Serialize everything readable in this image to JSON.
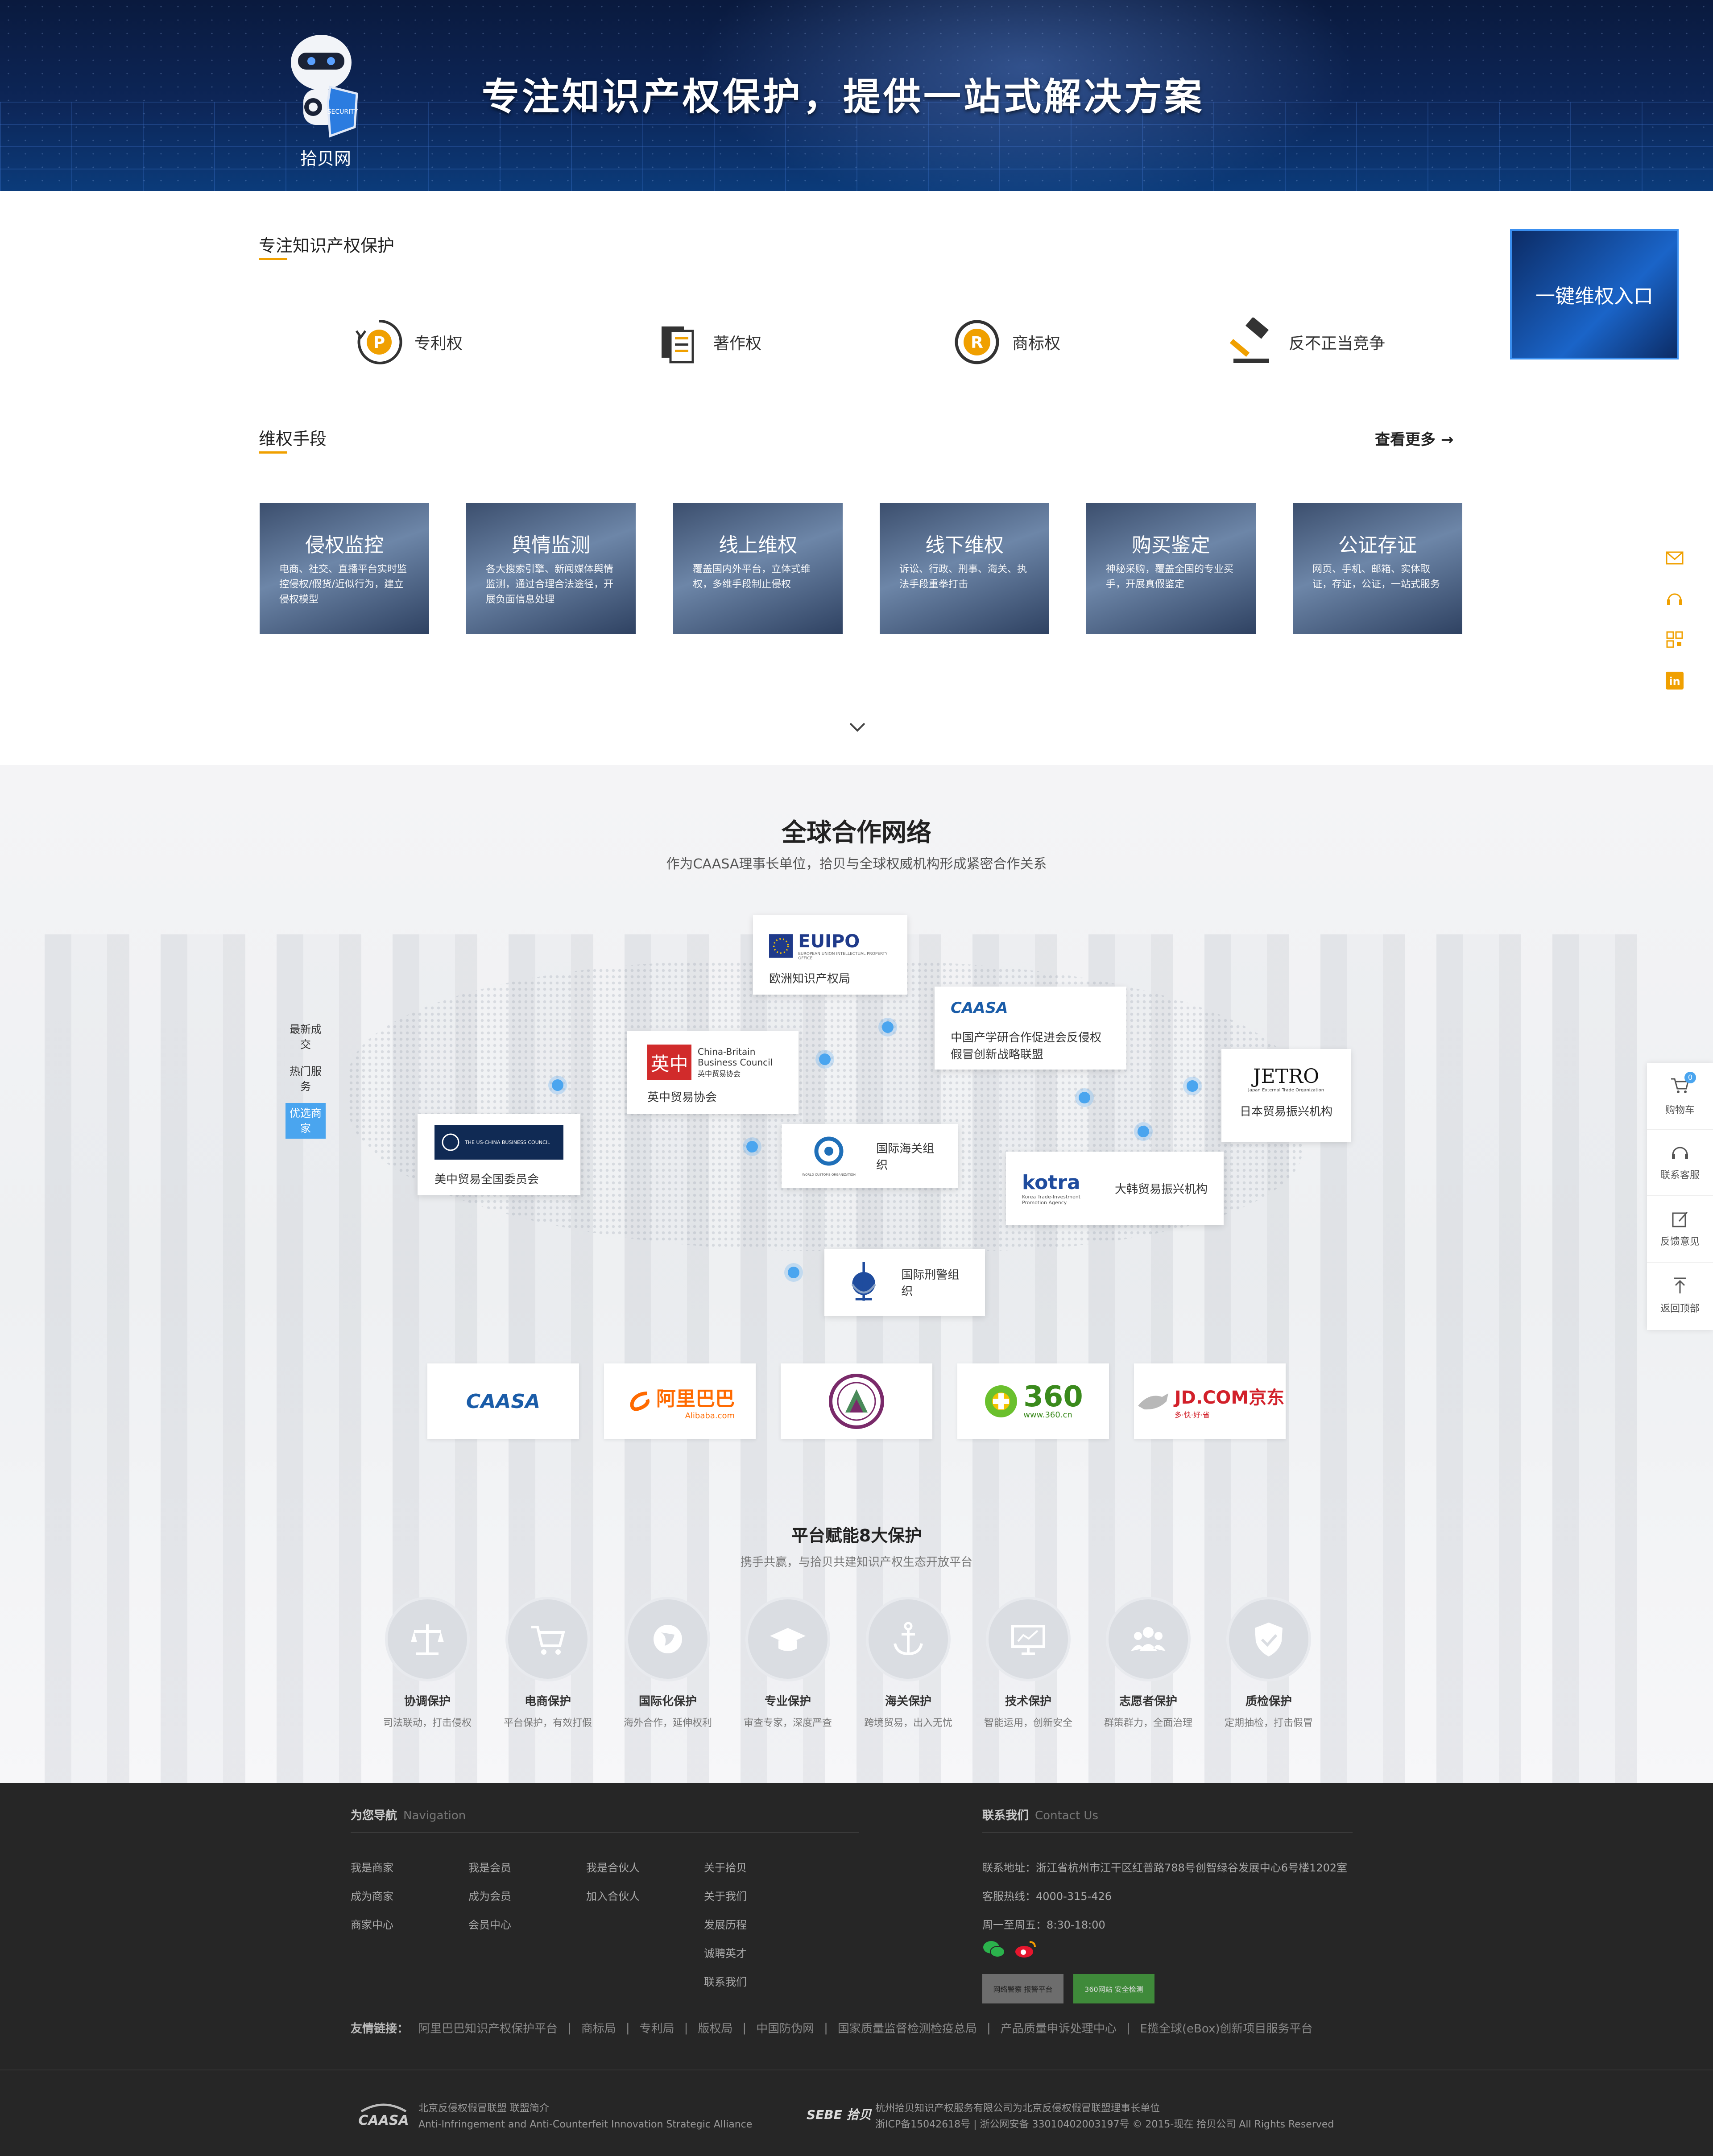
{
  "hero": {
    "slogan": "专注知识产权保护，提供一站式解决方案",
    "logo_text": "拾贝网",
    "colors": {
      "bg": "#0d2658",
      "accent": "#f0a000"
    }
  },
  "ip": {
    "title": "专注知识产权保护",
    "items": [
      {
        "label": "专利权",
        "icon": "patent-icon"
      },
      {
        "label": "著作权",
        "icon": "copyright-document-icon"
      },
      {
        "label": "商标权",
        "icon": "trademark-icon"
      },
      {
        "label": "反不正当竞争",
        "icon": "gavel-icon"
      }
    ],
    "oneclick_label": "一键维权入口"
  },
  "methods": {
    "title": "维权手段",
    "more_label": "查看更多",
    "cards": [
      {
        "title": "侵权监控",
        "desc": "电商、社交、直播平台实时监控侵权/假货/近似行为，建立侵权模型"
      },
      {
        "title": "舆情监测",
        "desc": "各大搜索引擎、新闻媒体舆情监测，通过合理合法途径，开展负面信息处理"
      },
      {
        "title": "线上维权",
        "desc": "覆盖国内外平台，立体式维权，多维手段制止侵权"
      },
      {
        "title": "线下维权",
        "desc": "诉讼、行政、刑事、海关、执法手段重拳打击"
      },
      {
        "title": "购买鉴定",
        "desc": "神秘采购，覆盖全国的专业买手，开展真假鉴定"
      },
      {
        "title": "公证存证",
        "desc": "网页、手机、邮箱、实体取证，存证，公证，一站式服务"
      }
    ]
  },
  "global": {
    "title": "全球合作网络",
    "subtitle": "作为CAASA理事长单位，拾贝与全球权威机构形成紧密合作关系",
    "side_labels": [
      "最新成交",
      "热门服务",
      "优选商家"
    ],
    "partners": {
      "euipo": {
        "logo": "EUIPO",
        "logo_sub": "EUROPEAN UNION INTELLECTUAL PROPERTY OFFICE",
        "name": "欧洲知识产权局"
      },
      "caasa": {
        "logo": "CAASA",
        "name": "中国产学研合作促进会反侵权假冒创新战略联盟"
      },
      "cbbc": {
        "logo_cn": "英中",
        "logo_en": "China-Britain Business Council",
        "logo_sub": "英中贸易协会",
        "name": "英中贸易协会"
      },
      "jetro": {
        "logo": "JETRO",
        "logo_sub": "Japan External Trade Organization",
        "name": "日本贸易振兴机构"
      },
      "uscbc": {
        "logo": "THE US-CHINA BUSINESS COUNCIL",
        "name": "美中贸易全国委员会"
      },
      "wco": {
        "logo_sub": "WORLD CUSTOMS ORGANIZATION",
        "name": "国际海关组织"
      },
      "kotra": {
        "logo": "kotra",
        "logo_sub": "Korea Trade-Investment Promotion Agency",
        "name": "大韩贸易振兴机构"
      },
      "interpol": {
        "name": "国际刑警组织"
      }
    },
    "brands": [
      {
        "name": "caasa",
        "text": "CAASA"
      },
      {
        "name": "alibaba",
        "text": "阿里巴巴",
        "sub": "Alibaba.com"
      },
      {
        "name": "emblem",
        "text": ""
      },
      {
        "name": "360",
        "text": "360",
        "sub": "www.360.cn"
      },
      {
        "name": "jd",
        "text": "JD.COM京东",
        "sub": "多·快·好·省"
      }
    ]
  },
  "protection": {
    "title": "平台赋能8大保护",
    "subtitle": "携手共赢，与拾贝共建知识产权生态开放平台",
    "items": [
      {
        "name": "协调保护",
        "desc": "司法联动，打击侵权",
        "icon": "scales-icon"
      },
      {
        "name": "电商保护",
        "desc": "平台保护，有效打假",
        "icon": "cart-icon"
      },
      {
        "name": "国际化保护",
        "desc": "海外合作，延伸权利",
        "icon": "globe-icon"
      },
      {
        "name": "专业保护",
        "desc": "审查专家，深度严查",
        "icon": "graduation-cap-icon"
      },
      {
        "name": "海关保护",
        "desc": "跨境贸易，出入无忧",
        "icon": "anchor-icon"
      },
      {
        "name": "技术保护",
        "desc": "智能运用，创新安全",
        "icon": "monitor-icon"
      },
      {
        "name": "志愿者保护",
        "desc": "群策群力，全面治理",
        "icon": "people-icon"
      },
      {
        "name": "质检保护",
        "desc": "定期抽检，打击假冒",
        "icon": "shield-check-icon"
      }
    ]
  },
  "right_toolbar": [
    {
      "label": "购物车",
      "icon": "cart-icon",
      "badge": "0"
    },
    {
      "label": "联系客服",
      "icon": "headset-icon"
    },
    {
      "label": "反馈意见",
      "icon": "edit-icon"
    },
    {
      "label": "返回顶部",
      "icon": "back-to-top-icon"
    }
  ],
  "footer": {
    "nav_title": "为您导航",
    "nav_title_en": "Navigation",
    "nav_cols": [
      [
        "我是商家",
        "成为商家",
        "商家中心"
      ],
      [
        "我是会员",
        "成为会员",
        "会员中心"
      ],
      [
        "我是合伙人",
        "加入合伙人"
      ],
      [
        "关于拾贝",
        "关于我们",
        "发展历程",
        "诚聘英才",
        "联系我们"
      ]
    ],
    "contact_title": "联系我们",
    "contact_title_en": "Contact Us",
    "address": "联系地址：浙江省杭州市江干区红普路788号创智绿谷发展中心6号楼1202室",
    "hotline": "客服热线：4000-315-426",
    "hours": "周一至周五：8:30-18:00",
    "badge1": "网络警察 报警平台",
    "badge2": "360网站 安全检测",
    "links_label": "友情链接：",
    "links": [
      "阿里巴巴知识产权保护平台",
      "商标局",
      "专利局",
      "版权局",
      "中国防伪网",
      "国家质量监督检测检疫总局",
      "产品质量申诉处理中心",
      "E揽全球(eBox)创新项目服务平台"
    ],
    "alliance_cn": "北京反侵权假冒联盟 联盟简介",
    "alliance_en": "Anti-Infringement and Anti-Counterfeit Innovation Strategic Alliance",
    "sebe_logo": "SEBE 拾贝",
    "company": "杭州拾贝知识产权服务有限公司为北京反侵权假冒联盟理事长单位",
    "icp": "浙ICP备15042618号 | 浙公网安备 33010402003197号 © 2015-现在 拾贝公司 All Rights Reserved"
  }
}
